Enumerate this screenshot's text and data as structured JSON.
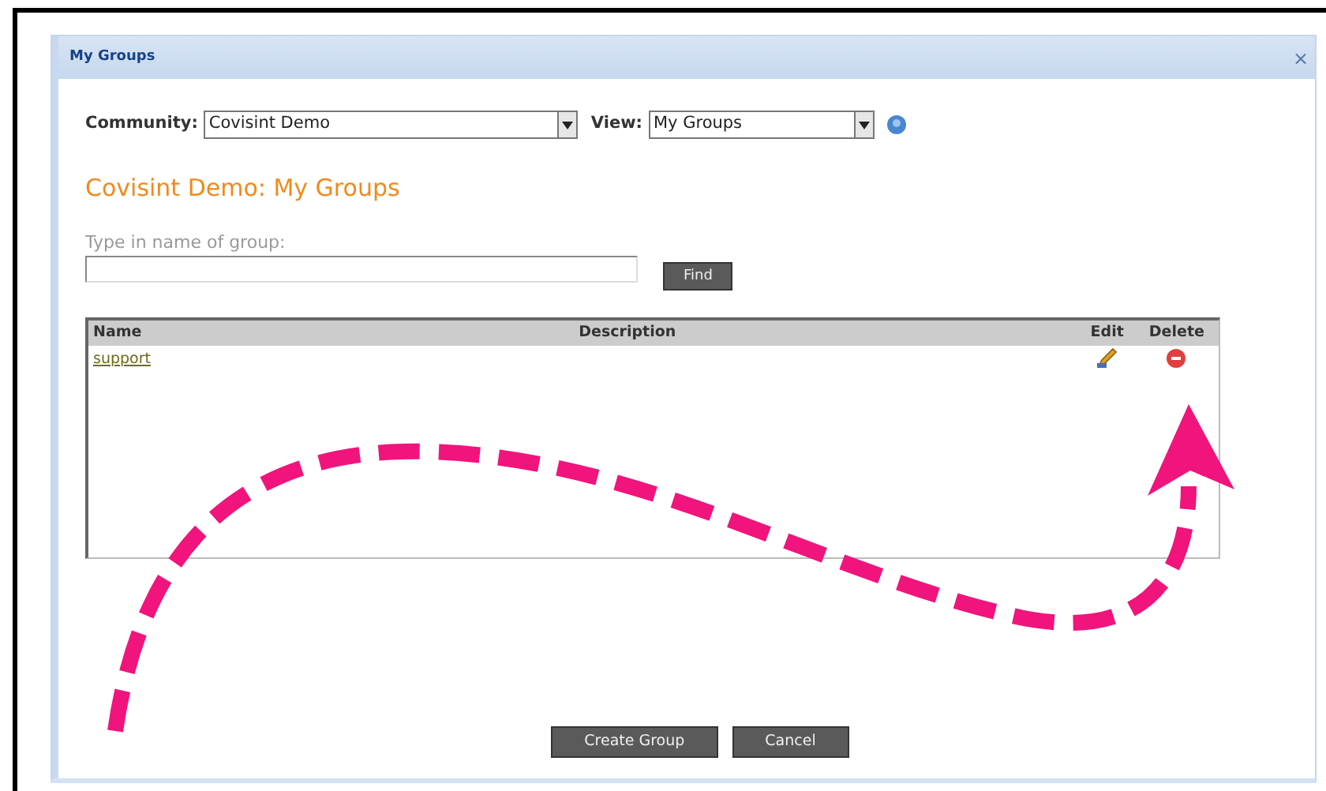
{
  "window": {
    "title": "My Groups",
    "close": "×"
  },
  "filters": [
    {
      "label": "Community:",
      "value": "Covisint Demo",
      "kind": "wide"
    },
    {
      "label": "View:",
      "value": "My Groups",
      "kind": "narrow"
    }
  ],
  "heading": "Covisint Demo: My Groups",
  "search": {
    "label": "Type in name of group:",
    "button": "Find"
  },
  "table": {
    "columns": [
      "Name",
      "Description",
      "Edit",
      "Delete"
    ],
    "rows": [
      {
        "name": "support"
      }
    ]
  },
  "buttons": [
    "Create Group",
    "Cancel"
  ]
}
